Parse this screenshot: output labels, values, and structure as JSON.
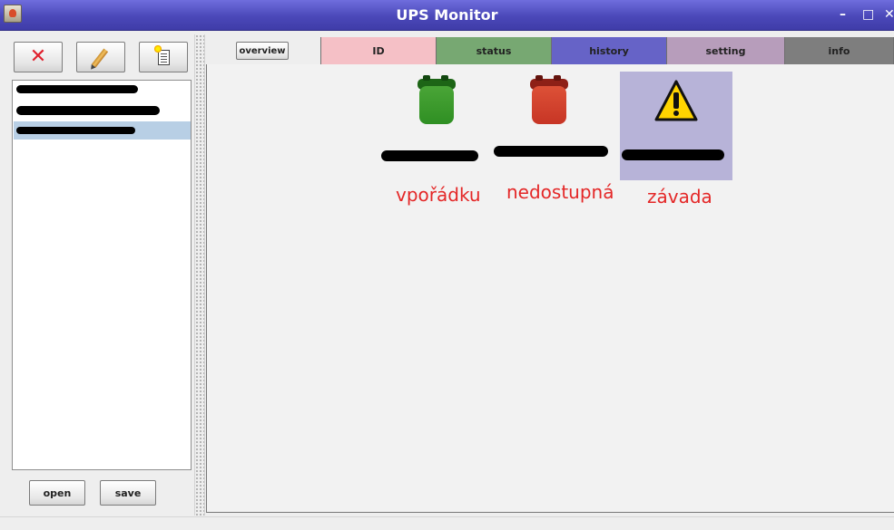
{
  "window": {
    "title": "UPS Monitor",
    "controls": {
      "minimize": "–",
      "maximize": "□",
      "close": "✕"
    }
  },
  "left_panel": {
    "toolbar": {
      "delete_icon": "delete-icon",
      "edit_icon": "pencil-icon",
      "new_icon": "new-document-icon"
    },
    "list_items": [
      {
        "selected": false
      },
      {
        "selected": false
      },
      {
        "selected": true
      }
    ],
    "buttons": {
      "open": "open",
      "save": "save"
    }
  },
  "tabs": [
    {
      "label": "overview",
      "color": "#eeeeee",
      "active": true
    },
    {
      "label": "ID",
      "color": "#f5c0c6"
    },
    {
      "label": "status",
      "color": "#77a872"
    },
    {
      "label": "history",
      "color": "#6663c7"
    },
    {
      "label": "setting",
      "color": "#b79dbb"
    },
    {
      "label": "info",
      "color": "#7e7e7e"
    }
  ],
  "devices": [
    {
      "status": "vpořádku",
      "icon": "green-battery-icon",
      "color": "#2f8f23"
    },
    {
      "status": "nedostupná",
      "icon": "red-battery-icon",
      "color": "#c73525"
    },
    {
      "status": "závada",
      "icon": "warning-icon",
      "color": "#ffd400",
      "selected": true
    }
  ],
  "colors": {
    "titlebar": "#5552c9",
    "status_text": "#e42727",
    "selection": "#b8cfe5",
    "device_selection": "#b7b3d8"
  }
}
